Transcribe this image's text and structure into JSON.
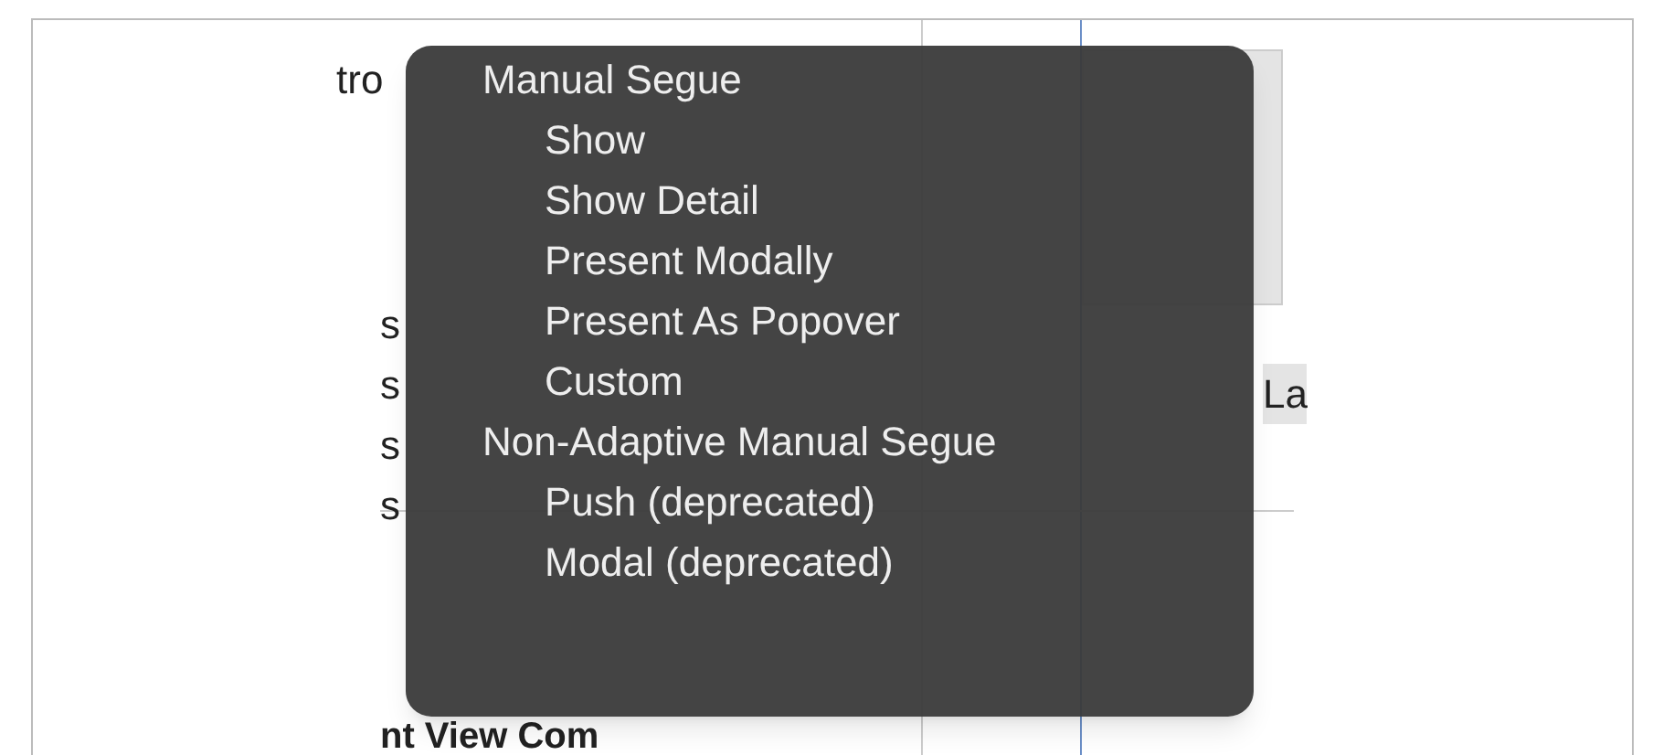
{
  "background": {
    "texts": [
      "tro",
      "s",
      "s",
      "s",
      "s",
      "La",
      "nt View Com"
    ]
  },
  "menu": {
    "items": [
      {
        "label": "Manual Segue",
        "kind": "header"
      },
      {
        "label": "Show",
        "kind": "option"
      },
      {
        "label": "Show Detail",
        "kind": "option"
      },
      {
        "label": "Present Modally",
        "kind": "option"
      },
      {
        "label": "Present As Popover",
        "kind": "option"
      },
      {
        "label": "Custom",
        "kind": "option"
      },
      {
        "label": "Non-Adaptive Manual Segue",
        "kind": "header"
      },
      {
        "label": "Push (deprecated)",
        "kind": "option"
      },
      {
        "label": "Modal (deprecated)",
        "kind": "option"
      }
    ]
  }
}
